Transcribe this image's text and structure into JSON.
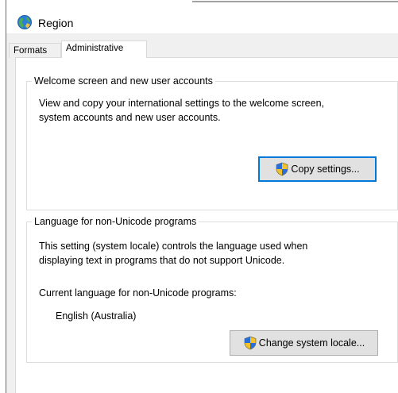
{
  "window": {
    "title": "Region"
  },
  "tabs": [
    {
      "label": "Formats",
      "selected": false
    },
    {
      "label": "Administrative",
      "selected": true
    }
  ],
  "welcome_group": {
    "legend": "Welcome screen and new user accounts",
    "description_line1": "View and copy your international settings to the welcome screen,",
    "description_line2": "system accounts and new user accounts.",
    "copy_button_label": "Copy settings..."
  },
  "locale_group": {
    "legend": "Language for non-Unicode programs",
    "description_line1": "This setting (system locale) controls the language used when",
    "description_line2": "displaying text in programs that do not support Unicode.",
    "current_label": "Current language for non-Unicode programs:",
    "current_value": "English (Australia)",
    "change_button_label": "Change system locale..."
  },
  "icons": {
    "title": "globe-icon",
    "uac": "uac-shield-icon"
  },
  "colors": {
    "focus_border": "#0078d7",
    "button_face": "#e1e1e1",
    "dialog_bg": "#f0f0f0"
  }
}
